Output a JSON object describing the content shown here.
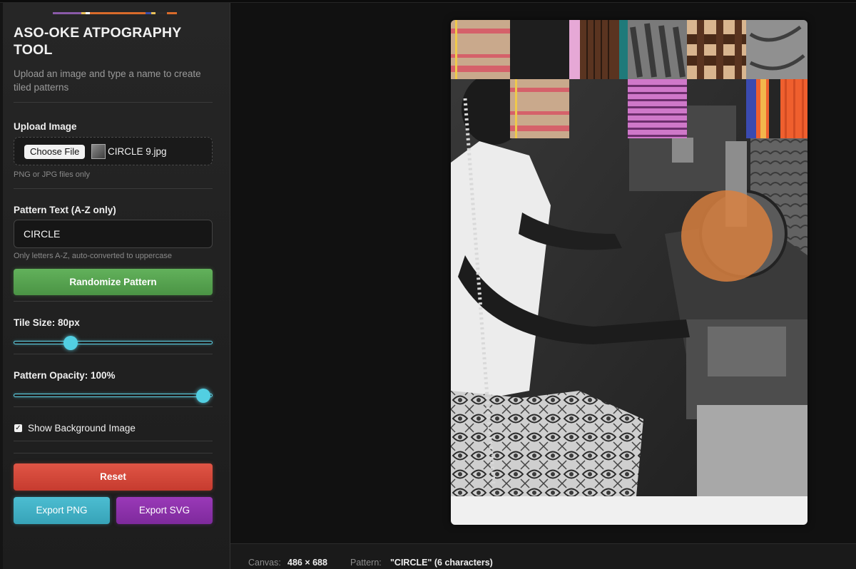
{
  "app": {
    "title": "ASO-OKE ATPOGRAPHY TOOL",
    "subtitle": "Upload an image and type a name to create tiled patterns"
  },
  "upload": {
    "label": "Upload Image",
    "button_label": "Choose File",
    "file_name": "CIRCLE 9.jpg",
    "hint": "PNG or JPG files only"
  },
  "pattern_text": {
    "label": "Pattern Text (A-Z only)",
    "value": "CIRCLE",
    "hint": "Only letters A-Z, auto-converted to uppercase"
  },
  "buttons": {
    "randomize": "Randomize Pattern",
    "reset": "Reset",
    "export_png": "Export PNG",
    "export_svg": "Export SVG"
  },
  "tile_size": {
    "label": "Tile Size: 80px",
    "fraction": 0.285
  },
  "pattern_opacity": {
    "label": "Pattern Opacity: 100%",
    "fraction": 0.955
  },
  "show_background": {
    "label": "Show Background Image",
    "checked": true,
    "check_glyph": "✓"
  },
  "status_bar": {
    "canvas_key": "Canvas:",
    "canvas_value": "486 × 688",
    "pattern_key": "Pattern:",
    "pattern_value": "\"CIRCLE\" (6 characters)"
  },
  "colors": {
    "accent_green": "#56a650",
    "accent_red": "#d94a3c",
    "accent_cyan": "#45b3c8",
    "accent_purple": "#8c33aa",
    "slider": "#52cfe2",
    "circle_orange": "#d8803f"
  },
  "icons": {
    "checkbox": "check-icon",
    "file_thumbnail": "image-thumbnail-icon"
  }
}
